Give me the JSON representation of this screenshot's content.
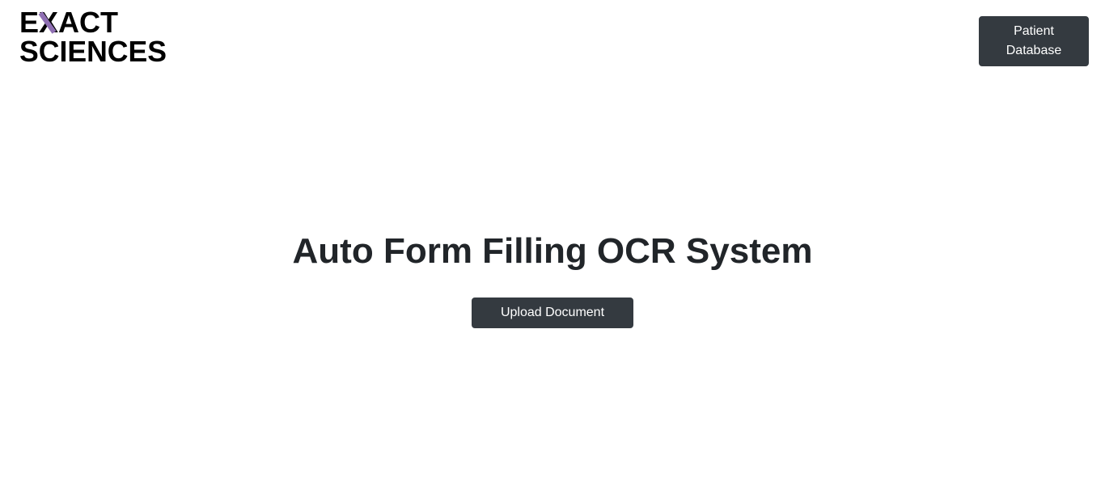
{
  "header": {
    "logo": {
      "line1": "EXACT",
      "line2": "SCIENCES",
      "accent_color": "#8f6fb3"
    },
    "nav_button": {
      "line1": "Patient",
      "line2": "Database"
    }
  },
  "main": {
    "title": "Auto Form Filling OCR System",
    "upload_button_label": "Upload Document"
  },
  "colors": {
    "button_bg": "#343a40",
    "button_text": "#ffffff",
    "title_text": "#212529",
    "page_bg": "#ffffff"
  }
}
